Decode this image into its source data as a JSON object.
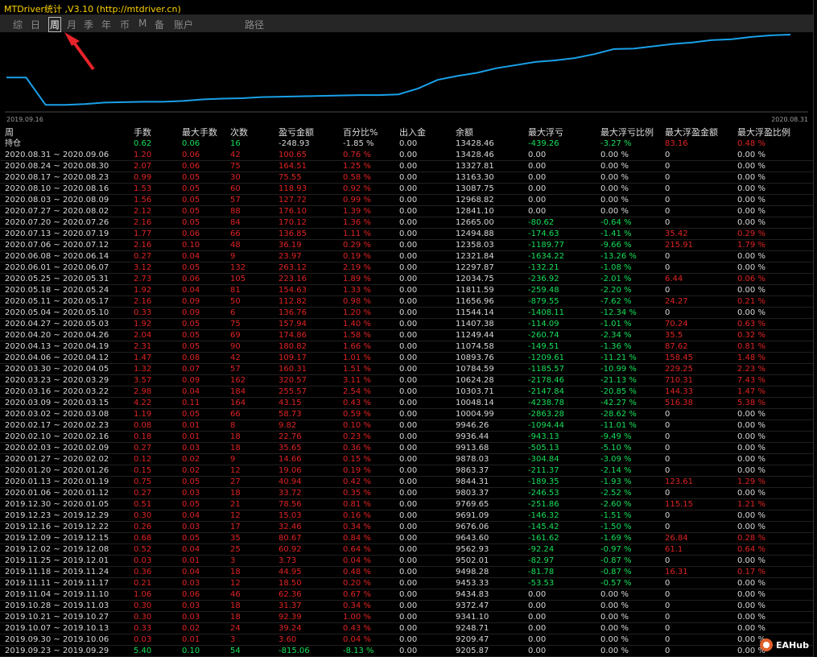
{
  "app": {
    "title": "MTDriver统计 ,V3.10 (http://mtdriver.cn)"
  },
  "tabs": [
    {
      "label": "综",
      "selected": false
    },
    {
      "label": "日",
      "selected": false
    },
    {
      "label": "周",
      "selected": true
    },
    {
      "label": "月",
      "selected": false
    },
    {
      "label": "季",
      "selected": false
    },
    {
      "label": "年",
      "selected": false
    },
    {
      "label": "币",
      "selected": false
    },
    {
      "label": "M",
      "selected": false
    },
    {
      "label": "备",
      "selected": false
    },
    {
      "label": "账户",
      "selected": false
    },
    {
      "label": "路径",
      "selected": false
    }
  ],
  "chart": {
    "start_label": "2019.09.16",
    "end_label": "2020.08.31",
    "line_color": "#1aa0e8"
  },
  "chart_data": {
    "type": "line",
    "x": [
      "2019.09.16",
      "2020.08.31"
    ],
    "values": [
      12040,
      12040,
      11690,
      11690,
      11700,
      11720,
      11725,
      11730,
      11730,
      11740,
      11760,
      11770,
      11775,
      11790,
      11795,
      11800,
      11805,
      11810,
      11815,
      11815,
      11825,
      11900,
      12010,
      12060,
      12100,
      12160,
      12200,
      12240,
      12260,
      12290,
      12340,
      12405,
      12410,
      12440,
      12470,
      12490,
      12520,
      12530,
      12560,
      12580,
      12590
    ],
    "ylim": [
      11600,
      12600
    ],
    "grid": false
  },
  "logo": {
    "text": "EAHub"
  },
  "table": {
    "header": [
      "周",
      "手数",
      "最大手数",
      "次数",
      "盈亏金额",
      "百分比%",
      "出入金",
      "余额",
      "最大浮亏",
      "最大浮亏比例",
      "最大浮盈金额",
      "最大浮盈比例"
    ],
    "holding": [
      "持仓",
      "0.62",
      "0.06",
      "16",
      "-248.93",
      "-1.85 %",
      "0.00",
      "13428.46",
      "-439.26",
      "-3.27 %",
      "83.16",
      "0.48 %"
    ],
    "rows": [
      [
        "2020.08.31 ~ 2020.09.06",
        "1.20",
        "0.06",
        "42",
        "100.65",
        "0.76 %",
        "0.00",
        "13428.46",
        "0.00",
        "0.00 %",
        "0",
        "0.00 %"
      ],
      [
        "2020.08.24 ~ 2020.08.30",
        "2.07",
        "0.06",
        "75",
        "164.51",
        "1.25 %",
        "0.00",
        "13327.81",
        "0.00",
        "0.00 %",
        "0",
        "0.00 %"
      ],
      [
        "2020.08.17 ~ 2020.08.23",
        "0.99",
        "0.05",
        "30",
        "75.55",
        "0.58 %",
        "0.00",
        "13163.30",
        "0.00",
        "0.00 %",
        "0",
        "0.00 %"
      ],
      [
        "2020.08.10 ~ 2020.08.16",
        "1.53",
        "0.05",
        "60",
        "118.93",
        "0.92 %",
        "0.00",
        "13087.75",
        "0.00",
        "0.00 %",
        "0",
        "0.00 %"
      ],
      [
        "2020.08.03 ~ 2020.08.09",
        "1.56",
        "0.05",
        "57",
        "127.72",
        "0.99 %",
        "0.00",
        "12968.82",
        "0.00",
        "0.00 %",
        "0",
        "0.00 %"
      ],
      [
        "2020.07.27 ~ 2020.08.02",
        "2.12",
        "0.05",
        "88",
        "176.10",
        "1.39 %",
        "0.00",
        "12841.10",
        "0.00",
        "0.00 %",
        "0",
        "0.00 %"
      ],
      [
        "2020.07.20 ~ 2020.07.26",
        "2.16",
        "0.05",
        "84",
        "170.12",
        "1.36 %",
        "0.00",
        "12665.00",
        "-80.62",
        "-0.64 %",
        "0",
        "0.00 %"
      ],
      [
        "2020.07.13 ~ 2020.07.19",
        "1.77",
        "0.06",
        "66",
        "136.85",
        "1.11 %",
        "0.00",
        "12494.88",
        "-174.63",
        "-1.41 %",
        "35.42",
        "0.29 %"
      ],
      [
        "2020.07.06 ~ 2020.07.12",
        "2.16",
        "0.10",
        "48",
        "36.19",
        "0.29 %",
        "0.00",
        "12358.03",
        "-1189.77",
        "-9.66 %",
        "215.91",
        "1.79 %"
      ],
      [
        "2020.06.08 ~ 2020.06.14",
        "0.27",
        "0.04",
        "9",
        "23.97",
        "0.19 %",
        "0.00",
        "12321.84",
        "-1634.22",
        "-13.26 %",
        "0",
        "0.00 %"
      ],
      [
        "2020.06.01 ~ 2020.06.07",
        "3.12",
        "0.05",
        "132",
        "263.12",
        "2.19 %",
        "0.00",
        "12297.87",
        "-132.21",
        "-1.08 %",
        "0",
        "0.00 %"
      ],
      [
        "2020.05.25 ~ 2020.05.31",
        "2.73",
        "0.06",
        "105",
        "223.16",
        "1.89 %",
        "0.00",
        "12034.75",
        "-236.92",
        "-2.01 %",
        "6.44",
        "0.06 %"
      ],
      [
        "2020.05.18 ~ 2020.05.24",
        "1.92",
        "0.04",
        "81",
        "154.63",
        "1.33 %",
        "0.00",
        "11811.59",
        "-259.48",
        "-2.20 %",
        "0",
        "0.00 %"
      ],
      [
        "2020.05.11 ~ 2020.05.17",
        "2.16",
        "0.09",
        "50",
        "112.82",
        "0.98 %",
        "0.00",
        "11656.96",
        "-879.55",
        "-7.62 %",
        "24.27",
        "0.21 %"
      ],
      [
        "2020.05.04 ~ 2020.05.10",
        "0.33",
        "0.09",
        "6",
        "136.76",
        "1.20 %",
        "0.00",
        "11544.14",
        "-1408.11",
        "-12.34 %",
        "0",
        "0.00 %"
      ],
      [
        "2020.04.27 ~ 2020.05.03",
        "1.92",
        "0.05",
        "75",
        "157.94",
        "1.40 %",
        "0.00",
        "11407.38",
        "-114.09",
        "-1.01 %",
        "70.24",
        "0.63 %"
      ],
      [
        "2020.04.20 ~ 2020.04.26",
        "2.04",
        "0.05",
        "69",
        "174.86",
        "1.58 %",
        "0.00",
        "11249.44",
        "-260.74",
        "-2.34 %",
        "35.5",
        "0.32 %"
      ],
      [
        "2020.04.13 ~ 2020.04.19",
        "2.31",
        "0.05",
        "90",
        "180.82",
        "1.66 %",
        "0.00",
        "11074.58",
        "-149.51",
        "-1.36 %",
        "87.62",
        "0.81 %"
      ],
      [
        "2020.04.06 ~ 2020.04.12",
        "1.47",
        "0.08",
        "42",
        "109.17",
        "1.01 %",
        "0.00",
        "10893.76",
        "-1209.61",
        "-11.21 %",
        "158.45",
        "1.48 %"
      ],
      [
        "2020.03.30 ~ 2020.04.05",
        "1.32",
        "0.07",
        "57",
        "160.31",
        "1.51 %",
        "0.00",
        "10784.59",
        "-1185.57",
        "-10.99 %",
        "229.25",
        "2.23 %"
      ],
      [
        "2020.03.23 ~ 2020.03.29",
        "3.57",
        "0.09",
        "162",
        "320.57",
        "3.11 %",
        "0.00",
        "10624.28",
        "-2178.46",
        "-21.13 %",
        "710.31",
        "7.43 %"
      ],
      [
        "2020.03.16 ~ 2020.03.22",
        "2.98",
        "0.04",
        "184",
        "255.57",
        "2.54 %",
        "0.00",
        "10303.71",
        "-2147.84",
        "-20.85 %",
        "144.33",
        "1.47 %"
      ],
      [
        "2020.03.09 ~ 2020.03.15",
        "4.22",
        "0.11",
        "164",
        "43.15",
        "0.43 %",
        "0.00",
        "10048.14",
        "-4238.78",
        "-42.27 %",
        "516.38",
        "5.38 %"
      ],
      [
        "2020.03.02 ~ 2020.03.08",
        "1.19",
        "0.05",
        "66",
        "58.73",
        "0.59 %",
        "0.00",
        "10004.99",
        "-2863.28",
        "-28.62 %",
        "0",
        "0.00 %"
      ],
      [
        "2020.02.17 ~ 2020.02.23",
        "0.08",
        "0.01",
        "8",
        "9.82",
        "0.10 %",
        "0.00",
        "9946.26",
        "-1094.44",
        "-11.01 %",
        "0",
        "0.00 %"
      ],
      [
        "2020.02.10 ~ 2020.02.16",
        "0.18",
        "0.01",
        "18",
        "22.76",
        "0.23 %",
        "0.00",
        "9936.44",
        "-943.13",
        "-9.49 %",
        "0",
        "0.00 %"
      ],
      [
        "2020.02.03 ~ 2020.02.09",
        "0.27",
        "0.03",
        "18",
        "35.65",
        "0.36 %",
        "0.00",
        "9913.68",
        "-505.13",
        "-5.10 %",
        "0",
        "0.00 %"
      ],
      [
        "2020.01.27 ~ 2020.02.02",
        "0.12",
        "0.02",
        "9",
        "14.66",
        "0.15 %",
        "0.00",
        "9878.03",
        "-304.84",
        "-3.09 %",
        "0",
        "0.00 %"
      ],
      [
        "2020.01.20 ~ 2020.01.26",
        "0.15",
        "0.02",
        "12",
        "19.06",
        "0.19 %",
        "0.00",
        "9863.37",
        "-211.37",
        "-2.14 %",
        "0",
        "0.00 %"
      ],
      [
        "2020.01.13 ~ 2020.01.19",
        "0.75",
        "0.05",
        "27",
        "40.94",
        "0.42 %",
        "0.00",
        "9844.31",
        "-189.35",
        "-1.93 %",
        "123.61",
        "1.29 %"
      ],
      [
        "2020.01.06 ~ 2020.01.12",
        "0.27",
        "0.03",
        "18",
        "33.72",
        "0.35 %",
        "0.00",
        "9803.37",
        "-246.53",
        "-2.52 %",
        "0",
        "0.00 %"
      ],
      [
        "2019.12.30 ~ 2020.01.05",
        "0.51",
        "0.05",
        "21",
        "78.56",
        "0.81 %",
        "0.00",
        "9769.65",
        "-251.86",
        "-2.60 %",
        "115.15",
        "1.21 %"
      ],
      [
        "2019.12.23 ~ 2019.12.29",
        "0.30",
        "0.04",
        "12",
        "15.03",
        "0.16 %",
        "0.00",
        "9691.09",
        "-146.32",
        "-1.51 %",
        "0",
        "0.00 %"
      ],
      [
        "2019.12.16 ~ 2019.12.22",
        "0.26",
        "0.03",
        "17",
        "32.46",
        "0.34 %",
        "0.00",
        "9676.06",
        "-145.42",
        "-1.50 %",
        "0",
        "0.00 %"
      ],
      [
        "2019.12.09 ~ 2019.12.15",
        "0.68",
        "0.05",
        "35",
        "80.67",
        "0.84 %",
        "0.00",
        "9643.60",
        "-161.62",
        "-1.69 %",
        "26.84",
        "0.28 %"
      ],
      [
        "2019.12.02 ~ 2019.12.08",
        "0.52",
        "0.04",
        "25",
        "60.92",
        "0.64 %",
        "0.00",
        "9562.93",
        "-92.24",
        "-0.97 %",
        "61.1",
        "0.64 %"
      ],
      [
        "2019.11.25 ~ 2019.12.01",
        "0.03",
        "0.01",
        "3",
        "3.73",
        "0.04 %",
        "0.00",
        "9502.01",
        "-82.97",
        "-0.87 %",
        "0",
        "0.00 %"
      ],
      [
        "2019.11.18 ~ 2019.11.24",
        "0.36",
        "0.04",
        "18",
        "44.95",
        "0.48 %",
        "0.00",
        "9498.28",
        "-81.78",
        "-0.87 %",
        "16.31",
        "0.17 %"
      ],
      [
        "2019.11.11 ~ 2019.11.17",
        "0.21",
        "0.03",
        "12",
        "18.50",
        "0.20 %",
        "0.00",
        "9453.33",
        "-53.53",
        "-0.57 %",
        "0",
        "0.00 %"
      ],
      [
        "2019.11.04 ~ 2019.11.10",
        "1.06",
        "0.06",
        "46",
        "62.36",
        "0.67 %",
        "0.00",
        "9434.83",
        "0.00",
        "0.00 %",
        "0",
        "0.00 %"
      ],
      [
        "2019.10.28 ~ 2019.11.03",
        "0.30",
        "0.03",
        "18",
        "31.37",
        "0.34 %",
        "0.00",
        "9372.47",
        "0.00",
        "0.00 %",
        "0",
        "0.00 %"
      ],
      [
        "2019.10.21 ~ 2019.10.27",
        "0.30",
        "0.03",
        "18",
        "92.39",
        "1.00 %",
        "0.00",
        "9341.10",
        "0.00",
        "0.00 %",
        "0",
        "0.00 %"
      ],
      [
        "2019.10.07 ~ 2019.10.13",
        "0.33",
        "0.02",
        "24",
        "39.24",
        "0.43 %",
        "0.00",
        "9248.71",
        "0.00",
        "0.00 %",
        "0",
        "0.00 %"
      ],
      [
        "2019.09.30 ~ 2019.10.06",
        "0.03",
        "0.01",
        "3",
        "3.60",
        "0.04 %",
        "0.00",
        "9209.47",
        "0.00",
        "0.00 %",
        "0",
        "0.00 %"
      ],
      [
        "2019.09.23 ~ 2019.09.29",
        "5.40",
        "0.10",
        "54",
        "-815.06",
        "-8.13 %",
        "0.00",
        "9205.87",
        "0.00",
        "0.00 %",
        "0",
        "0.00 %"
      ]
    ]
  }
}
